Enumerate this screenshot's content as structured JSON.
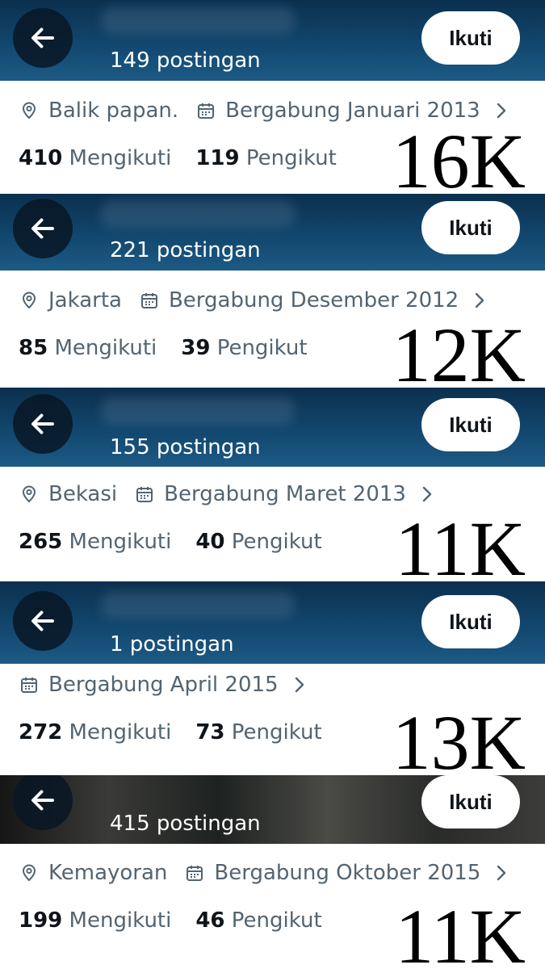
{
  "profiles": [
    {
      "posts": "149 postingan",
      "follow_label": "Ikuti",
      "location": "Balik papan.",
      "joined": "Bergabung Januari 2013",
      "following_count": "410",
      "following_label": "Mengikuti",
      "followers_count": "119",
      "followers_label": "Pengikut",
      "overlay": "16K"
    },
    {
      "posts": "221 postingan",
      "follow_label": "Ikuti",
      "location": "Jakarta",
      "joined": "Bergabung Desember 2012",
      "following_count": "85",
      "following_label": "Mengikuti",
      "followers_count": "39",
      "followers_label": "Pengikut",
      "overlay": "12K"
    },
    {
      "posts": "155 postingan",
      "follow_label": "Ikuti",
      "location": "Bekasi",
      "joined": "Bergabung Maret 2013",
      "following_count": "265",
      "following_label": "Mengikuti",
      "followers_count": "40",
      "followers_label": "Pengikut",
      "overlay": "11K"
    },
    {
      "posts": "1 postingan",
      "follow_label": "Ikuti",
      "joined": "Bergabung April 2015",
      "following_count": "272",
      "following_label": "Mengikuti",
      "followers_count": "73",
      "followers_label": "Pengikut",
      "overlay": "13K"
    },
    {
      "posts": "415 postingan",
      "follow_label": "Ikuti",
      "location": "Kemayoran",
      "joined": "Bergabung Oktober 2015",
      "following_count": "199",
      "following_label": "Mengikuti",
      "followers_count": "46",
      "followers_label": "Pengikut",
      "overlay": "11K"
    }
  ],
  "icons": {
    "back": "arrow-left-icon",
    "location": "location-pin-icon",
    "calendar": "calendar-icon",
    "chevron": "chevron-right-icon"
  },
  "colors": {
    "header_blue": "#12476e",
    "muted_text": "#536471",
    "primary_text": "#0f1419"
  }
}
